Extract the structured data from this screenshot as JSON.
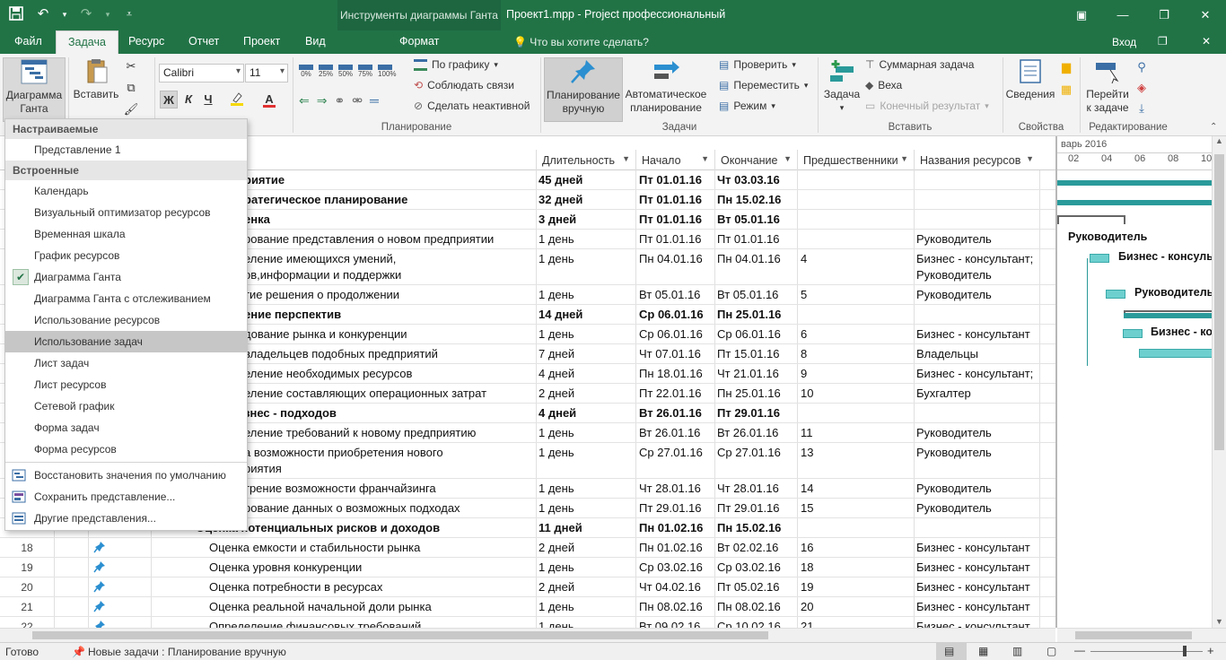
{
  "window": {
    "context_tab_group": "Инструменты диаграммы Ганта",
    "title": "Проект1.mpp - Project профессиональный",
    "minimize": "—",
    "restore": "❐",
    "close": "✕"
  },
  "tabs": [
    {
      "label": "Файл"
    },
    {
      "label": "Задача",
      "active": true
    },
    {
      "label": "Ресурс"
    },
    {
      "label": "Отчет"
    },
    {
      "label": "Проект"
    },
    {
      "label": "Вид"
    },
    {
      "label": "Формат"
    }
  ],
  "tell_me": "Что вы хотите сделать?",
  "sign_in": "Вход",
  "ribbon": {
    "gantt_btn": "Диаграмма Ганта",
    "paste_btn": "Вставить",
    "font_name": "Calibri",
    "font_size": "11",
    "bold": "Ж",
    "italic": "К",
    "underline": "Ч",
    "pct_labels": [
      "0%",
      "25%",
      "50%",
      "75%",
      "100%"
    ],
    "on_track": "По графику",
    "respect_links": "Соблюдать связи",
    "inactivate": "Сделать неактивной",
    "planning_group": "Планирование",
    "manual_btn": "Планирование вручную",
    "auto_btn": "Автоматическое планирование",
    "tasks_group": "Задачи",
    "inspect": "Проверить",
    "move": "Переместить",
    "mode": "Режим",
    "task_btn": "Задача",
    "summary": "Суммарная задача",
    "milestone": "Веха",
    "deliverable": "Конечный результат",
    "insert_group": "Вставить",
    "info_btn": "Сведения",
    "props_group": "Свойства",
    "scroll_btn": "Перейти к задаче",
    "edit_group": "Редактирование"
  },
  "menu": {
    "custom_header": "Настраиваемые",
    "custom_items": [
      "Представление 1"
    ],
    "builtin_header": "Встроенные",
    "builtin_items": [
      "Календарь",
      "Визуальный оптимизатор ресурсов",
      "Временная шкала",
      "График ресурсов",
      "Диаграмма Ганта",
      "Диаграмма Ганта с отслеживанием",
      "Использование ресурсов",
      "Использование задач",
      "Лист задач",
      "Лист ресурсов",
      "Сетевой график",
      "Форма задач",
      "Форма ресурсов"
    ],
    "checked_item": "Диаграмма Ганта",
    "selected_item": "Использование задач",
    "reset": "Восстановить значения по умолчанию",
    "save_view": "Сохранить представление...",
    "more_views": "Другие представления..."
  },
  "columns": {
    "duration": "Длительность",
    "start": "Начало",
    "finish": "Окончание",
    "predecessors": "Предшественники",
    "resources": "Названия ресурсов"
  },
  "rows": [
    {
      "num": "",
      "name": "риятие",
      "dur": "45 дней",
      "start": "Пт 01.01.16",
      "finish": "Чт 03.03.16",
      "pred": "",
      "res": "",
      "bold": true
    },
    {
      "num": "",
      "name": "ратегическое планирование",
      "dur": "32 дней",
      "start": "Пт 01.01.16",
      "finish": "Пн 15.02.16",
      "pred": "",
      "res": "",
      "bold": true
    },
    {
      "num": "",
      "name": "енка",
      "dur": "3 дней",
      "start": "Пт 01.01.16",
      "finish": "Вт 05.01.16",
      "pred": "",
      "res": "",
      "bold": true
    },
    {
      "num": "",
      "name": "рование представления о новом предприятии",
      "dur": "1 день",
      "start": "Пт 01.01.16",
      "finish": "Пт 01.01.16",
      "pred": "",
      "res": "Руководитель"
    },
    {
      "num": "",
      "name": "еление имеющихся умений,",
      "name2": "ов,информации и поддержки",
      "dur": "1 день",
      "start": "Пн 04.01.16",
      "finish": "Пн 04.01.16",
      "pred": "4",
      "res": "Бизнес - консультант;",
      "res2": "Руководитель",
      "tall": true
    },
    {
      "num": "",
      "name": "тие решения о продолжении",
      "dur": "1 день",
      "start": "Вт 05.01.16",
      "finish": "Вт 05.01.16",
      "pred": "5",
      "res": "Руководитель"
    },
    {
      "num": "",
      "name": "ение перспектив",
      "dur": "14 дней",
      "start": "Ср 06.01.16",
      "finish": "Пн 25.01.16",
      "pred": "",
      "res": "",
      "bold": true
    },
    {
      "num": "",
      "name": "дование рынка и конкуренции",
      "dur": "1 день",
      "start": "Ср 06.01.16",
      "finish": "Ср 06.01.16",
      "pred": "6",
      "res": "Бизнес - консультант"
    },
    {
      "num": "",
      "name": "владельцев подобных предприятий",
      "dur": "7 дней",
      "start": "Чт 07.01.16",
      "finish": "Пт 15.01.16",
      "pred": "8",
      "res": "Владельцы"
    },
    {
      "num": "",
      "name": "еление необходимых ресурсов",
      "dur": "4 дней",
      "start": "Пн 18.01.16",
      "finish": "Чт 21.01.16",
      "pred": "9",
      "res": "Бизнес - консультант;"
    },
    {
      "num": "",
      "name": "еление составляющих операционных затрат",
      "dur": "2 дней",
      "start": "Пт 22.01.16",
      "finish": "Пн 25.01.16",
      "pred": "10",
      "res": "Бухгалтер"
    },
    {
      "num": "",
      "name": "знес - подходов",
      "dur": "4 дней",
      "start": "Вт 26.01.16",
      "finish": "Пт 29.01.16",
      "pred": "",
      "res": "",
      "bold": true
    },
    {
      "num": "",
      "name": "еление требований к новому предприятию",
      "dur": "1 день",
      "start": "Вт 26.01.16",
      "finish": "Вт 26.01.16",
      "pred": "11",
      "res": "Руководитель"
    },
    {
      "num": "",
      "name": "а возможности приобретения нового",
      "name2": "риятия",
      "dur": "1 день",
      "start": "Ср 27.01.16",
      "finish": "Ср 27.01.16",
      "pred": "13",
      "res": "Руководитель",
      "tall": true
    },
    {
      "num": "",
      "name": "трение возможности франчайзинга",
      "dur": "1 день",
      "start": "Чт 28.01.16",
      "finish": "Чт 28.01.16",
      "pred": "14",
      "res": "Руководитель"
    },
    {
      "num": "",
      "name": "рование данных о возможных подходах",
      "dur": "1 день",
      "start": "Пт 29.01.16",
      "finish": "Пт 29.01.16",
      "pred": "15",
      "res": "Руководитель"
    },
    {
      "num": "",
      "name": "Оценка потенциальных рисков и доходов",
      "dur": "11 дней",
      "start": "Пн 01.02.16",
      "finish": "Пн 15.02.16",
      "pred": "",
      "res": "",
      "bold": true
    },
    {
      "num": "18",
      "name": "Оценка емкости и стабильности рынка",
      "dur": "2 дней",
      "start": "Пн 01.02.16",
      "finish": "Вт 02.02.16",
      "pred": "16",
      "res": "Бизнес - консультант",
      "pin": true
    },
    {
      "num": "19",
      "name": "Оценка уровня конкуренции",
      "dur": "1 день",
      "start": "Ср 03.02.16",
      "finish": "Ср 03.02.16",
      "pred": "18",
      "res": "Бизнес - консультант",
      "pin": true
    },
    {
      "num": "20",
      "name": "Оценка потребности в ресурсах",
      "dur": "2 дней",
      "start": "Чт 04.02.16",
      "finish": "Пт 05.02.16",
      "pred": "19",
      "res": "Бизнес - консультант",
      "pin": true
    },
    {
      "num": "21",
      "name": "Оценка реальной начальной доли рынка",
      "dur": "1 день",
      "start": "Пн 08.02.16",
      "finish": "Пн 08.02.16",
      "pred": "20",
      "res": "Бизнес - консультант",
      "pin": true
    },
    {
      "num": "22",
      "name": "Определение финансовых требований",
      "dur": "1 день",
      "start": "Вт 09.02.16",
      "finish": "Ср 10.02.16",
      "pred": "21",
      "res": "Бизнес - консультант",
      "pin": true
    }
  ],
  "gantt": {
    "timescale_top": "варь 2016",
    "timescale_days": [
      "02",
      "04",
      "06",
      "08",
      "10"
    ],
    "labels": [
      "Руководитель",
      "Бизнес - консуль",
      "Руководитель",
      "Бизнес - ко"
    ]
  },
  "status": {
    "ready": "Готово",
    "new_tasks": "Новые задачи : Планирование вручную"
  },
  "colors": {
    "accent": "#217346",
    "gantt_bar": "#2a9a9a",
    "gantt_task": "#6dd0cf"
  }
}
